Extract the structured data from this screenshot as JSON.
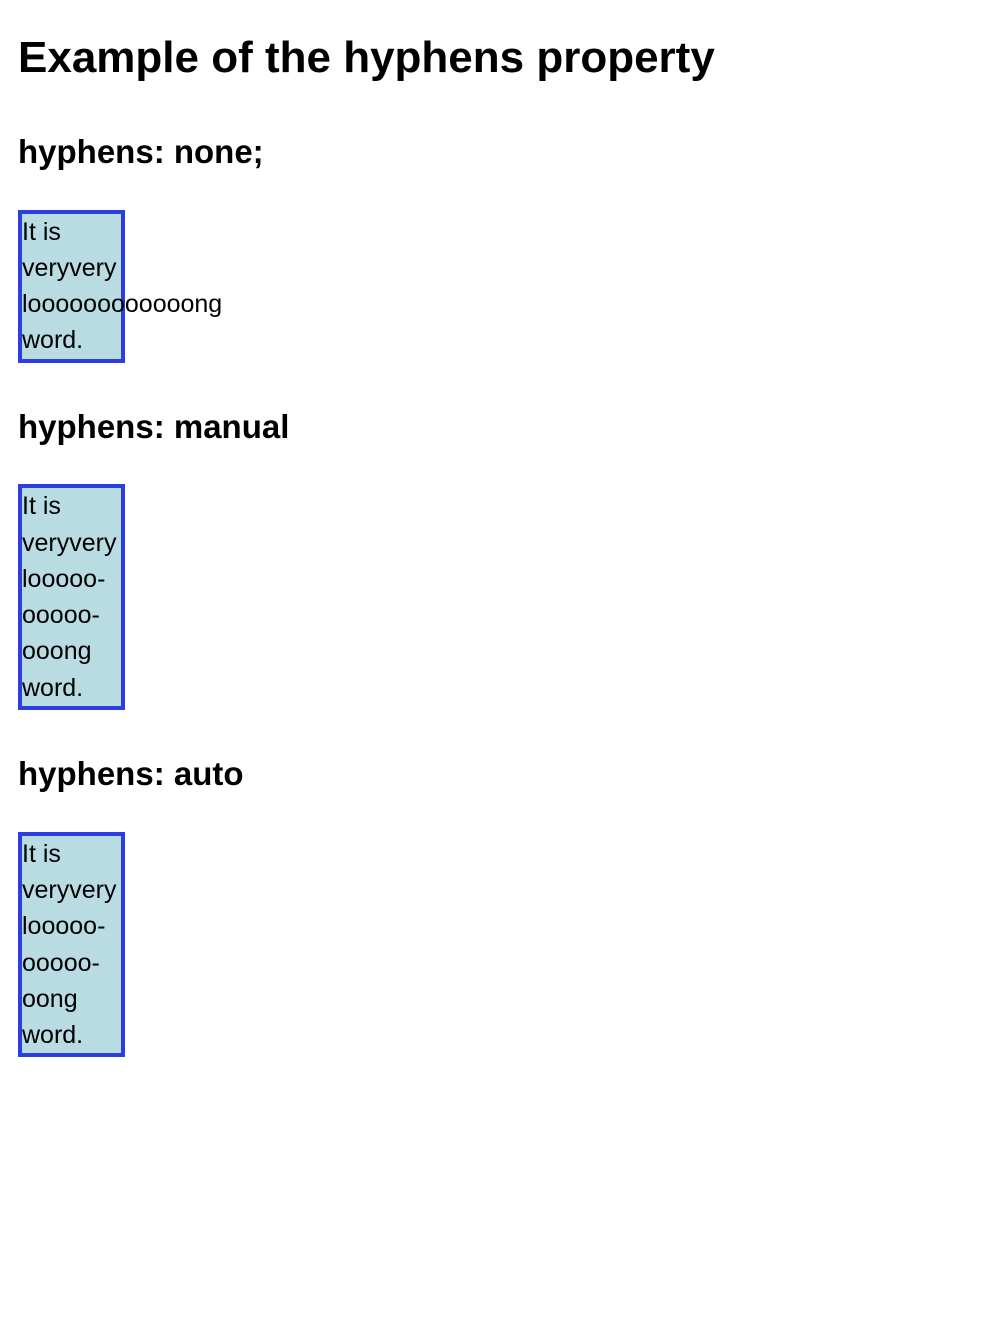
{
  "page_title": "Example of the hyphens property",
  "sections": {
    "none": {
      "heading": "hyphens: none;",
      "text": "It is veryvery loooooooooooong word."
    },
    "manual": {
      "heading": "hyphens: manual",
      "text_html": "It is very&shy;very looooo&shy;ooooo&shy;ooong word."
    },
    "auto": {
      "heading": "hyphens: auto",
      "text_html": "It is very&shy;very looooo&shy;ooooo&shy;oong word."
    }
  }
}
